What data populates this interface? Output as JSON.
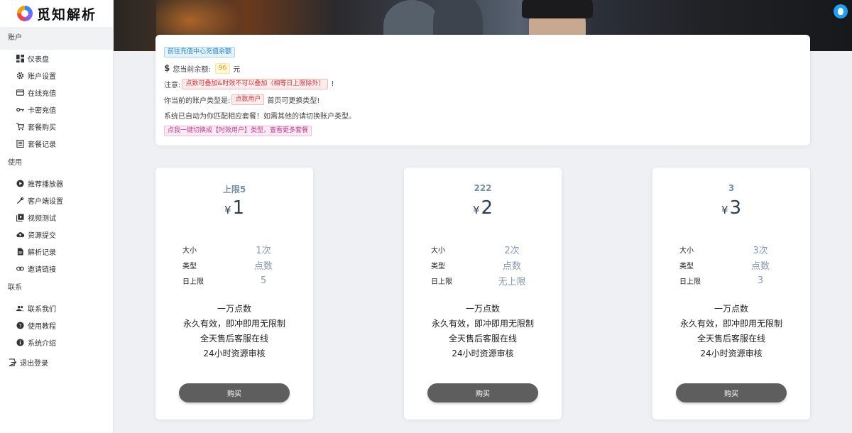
{
  "app": {
    "name": "觅知解析"
  },
  "sidebar": {
    "sections": [
      {
        "title": "账户",
        "items": [
          {
            "label": "仪表盘",
            "icon": "dashboard-icon"
          },
          {
            "label": "账户设置",
            "icon": "gear-icon"
          },
          {
            "label": "在线充值",
            "icon": "credit-card-icon"
          },
          {
            "label": "卡密充值",
            "icon": "key-icon"
          },
          {
            "label": "套餐购买",
            "icon": "cart-icon"
          },
          {
            "label": "套餐记录",
            "icon": "list-icon"
          }
        ]
      },
      {
        "title": "使用",
        "items": [
          {
            "label": "推荐播放器",
            "icon": "play-circle-icon"
          },
          {
            "label": "客户端设置",
            "icon": "wrench-icon"
          },
          {
            "label": "视频测试",
            "icon": "video-library-icon"
          },
          {
            "label": "资源提交",
            "icon": "cloud-upload-icon"
          },
          {
            "label": "解析记录",
            "icon": "document-icon"
          },
          {
            "label": "邀请链接",
            "icon": "link-icon"
          }
        ]
      },
      {
        "title": "联系",
        "items": [
          {
            "label": "联系我们",
            "icon": "people-icon"
          },
          {
            "label": "使用教程",
            "icon": "help-circle-icon"
          },
          {
            "label": "系统介绍",
            "icon": "info-icon"
          }
        ]
      }
    ],
    "logout": {
      "label": "退出登录",
      "icon": "logout-icon"
    }
  },
  "notice": {
    "recharge_tag": "前往充值中心充值余额",
    "balance_prefix": "您当前余额:",
    "balance_value": "96",
    "balance_unit": "元",
    "note_prefix": "注意:",
    "note_tag": "点数可叠加&时效不可以叠加（相等日上限除外）",
    "note_suffix": "!",
    "account_type_prefix": "你当前的账户类型是:",
    "account_type_tag": "点数用户",
    "account_type_suffix": "首页可更换类型!",
    "auto_match_text": "系统已自动为你匹配相应套餐！如需其他的请切换账户类型。",
    "switch_tag": "点我一键切换成【时效用户】类型，查看更多套餐"
  },
  "spec_labels": {
    "size": "大小",
    "type": "类型",
    "daily_limit": "日上限"
  },
  "plans": [
    {
      "name": "上限5",
      "currency": "¥",
      "price": "1",
      "size": "1次",
      "type": "点数",
      "daily_limit": "5",
      "features": [
        "一万点数",
        "永久有效，即冲即用无限制",
        "全天售后客服在线",
        "24小时资源审核"
      ],
      "buy_label": "购买"
    },
    {
      "name": "222",
      "currency": "¥",
      "price": "2",
      "size": "2次",
      "type": "点数",
      "daily_limit": "无上限",
      "features": [
        "一万点数",
        "永久有效，即冲即用无限制",
        "全天售后客服在线",
        "24小时资源审核"
      ],
      "buy_label": "购买"
    },
    {
      "name": "3",
      "currency": "¥",
      "price": "3",
      "size": "3次",
      "type": "点数",
      "daily_limit": "3",
      "features": [
        "一万点数",
        "永久有效，即冲即用无限制",
        "全天售后客服在线",
        "24小时资源审核"
      ],
      "buy_label": "购买"
    }
  ]
}
